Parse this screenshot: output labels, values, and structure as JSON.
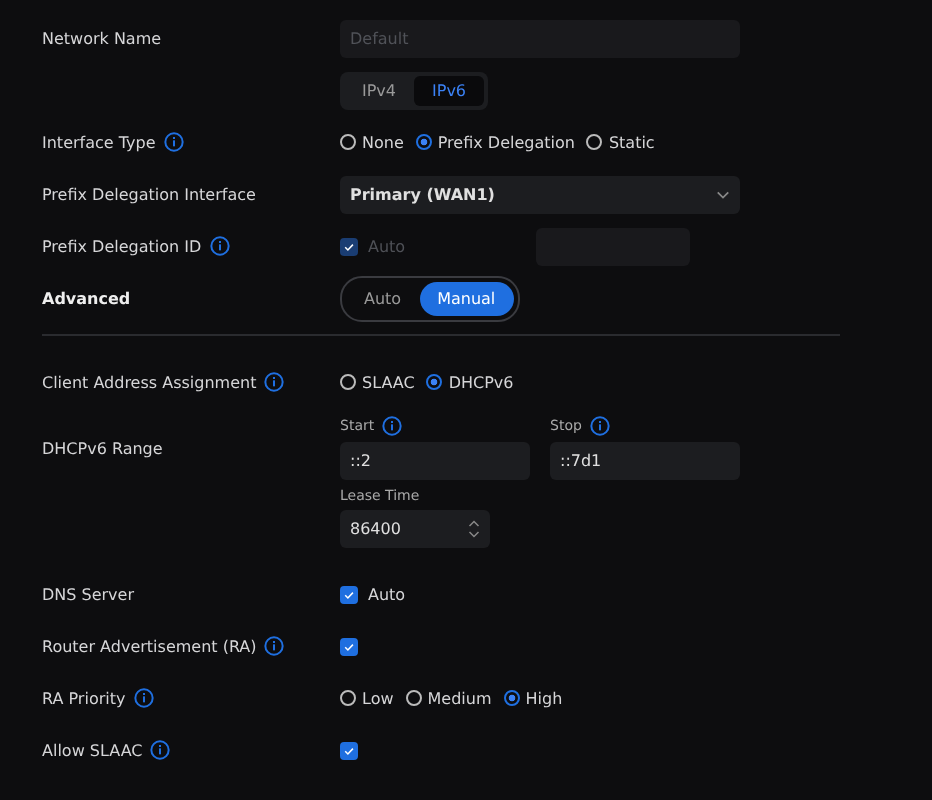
{
  "rows": [
    {
      "kind": "text",
      "label": "Network Name",
      "info": false,
      "placeholder": "Default",
      "disabled": true
    },
    {
      "kind": "segmented",
      "options": [
        {
          "label": "IPv4",
          "selected": false
        },
        {
          "label": "IPv6",
          "selected": true
        }
      ]
    },
    {
      "kind": "radio",
      "label": "Interface Type",
      "info": true,
      "options": [
        {
          "label": "None",
          "selected": false
        },
        {
          "label": "Prefix Delegation",
          "selected": true
        },
        {
          "label": "Static",
          "selected": false
        }
      ]
    },
    {
      "kind": "select",
      "label": "Prefix Delegation Interface",
      "info": false,
      "value": "Primary (WAN1)"
    },
    {
      "kind": "checkbox",
      "label": "Prefix Delegation ID",
      "info": true,
      "checked": true,
      "disabled": true,
      "text": "Auto",
      "side_field": true
    },
    {
      "kind": "toggle",
      "label": "Advanced",
      "info": false,
      "options": [
        {
          "label": "Auto",
          "selected": false
        },
        {
          "label": "Manual",
          "selected": true
        }
      ]
    },
    {
      "kind": "divider"
    },
    {
      "kind": "radio",
      "label": "Client Address Assignment",
      "info": true,
      "options": [
        {
          "label": "SLAAC",
          "selected": false
        },
        {
          "label": "DHCPv6",
          "selected": true
        }
      ]
    },
    {
      "kind": "range",
      "label": "DHCPv6 Range",
      "info": false,
      "fields": [
        {
          "caption": "Start",
          "info": true,
          "value": "::2"
        },
        {
          "caption": "Stop",
          "info": true,
          "value": "::7d1"
        }
      ]
    },
    {
      "kind": "number",
      "caption": "Lease Time",
      "value": "86400"
    },
    {
      "kind": "checkbox",
      "label": "DNS Server",
      "info": false,
      "checked": true,
      "disabled": false,
      "text": "Auto"
    },
    {
      "kind": "checkbox",
      "label": "Router Advertisement (RA)",
      "info": true,
      "checked": true,
      "disabled": false
    },
    {
      "kind": "radio",
      "label": "RA Priority",
      "info": true,
      "options": [
        {
          "label": "Low",
          "selected": false
        },
        {
          "label": "Medium",
          "selected": false
        },
        {
          "label": "High",
          "selected": true
        }
      ]
    },
    {
      "kind": "checkbox",
      "label": "Allow SLAAC",
      "info": true,
      "checked": true,
      "disabled": false
    }
  ]
}
